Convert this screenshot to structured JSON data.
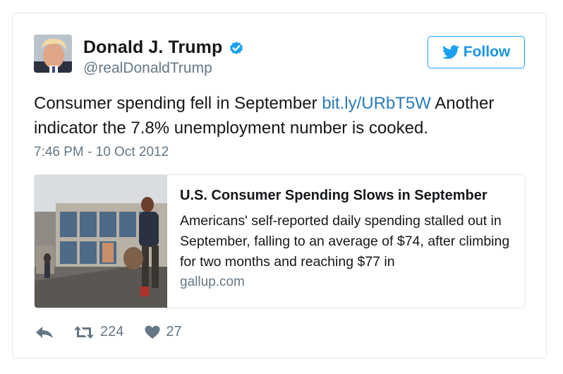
{
  "user": {
    "name": "Donald J. Trump",
    "handle": "@realDonaldTrump",
    "verified_icon": "verified-badge-icon"
  },
  "follow_button": {
    "label": "Follow",
    "icon": "twitter-bird-icon"
  },
  "tweet": {
    "text_before_link": "Consumer spending fell in September ",
    "link_text": "bit.ly/URbT5W",
    "text_after_link": " Another indicator the 7.8% unemployment number is cooked.",
    "timestamp": "7:46 PM - 10 Oct 2012"
  },
  "card": {
    "title": "U.S. Consumer Spending Slows in September",
    "description": "Americans' self-reported daily spending stalled out in September, falling to an average of $74, after climbing for two months and reaching $77 in",
    "domain": "gallup.com"
  },
  "actions": {
    "reply_icon": "reply-icon",
    "retweet_icon": "retweet-icon",
    "retweet_count": "224",
    "like_icon": "heart-icon",
    "like_count": "27"
  },
  "colors": {
    "link": "#2b7bb9",
    "follow_blue": "#1da1f2",
    "verified_blue": "#1da1f2",
    "muted_text": "#657786",
    "border": "#e1e8ed"
  }
}
